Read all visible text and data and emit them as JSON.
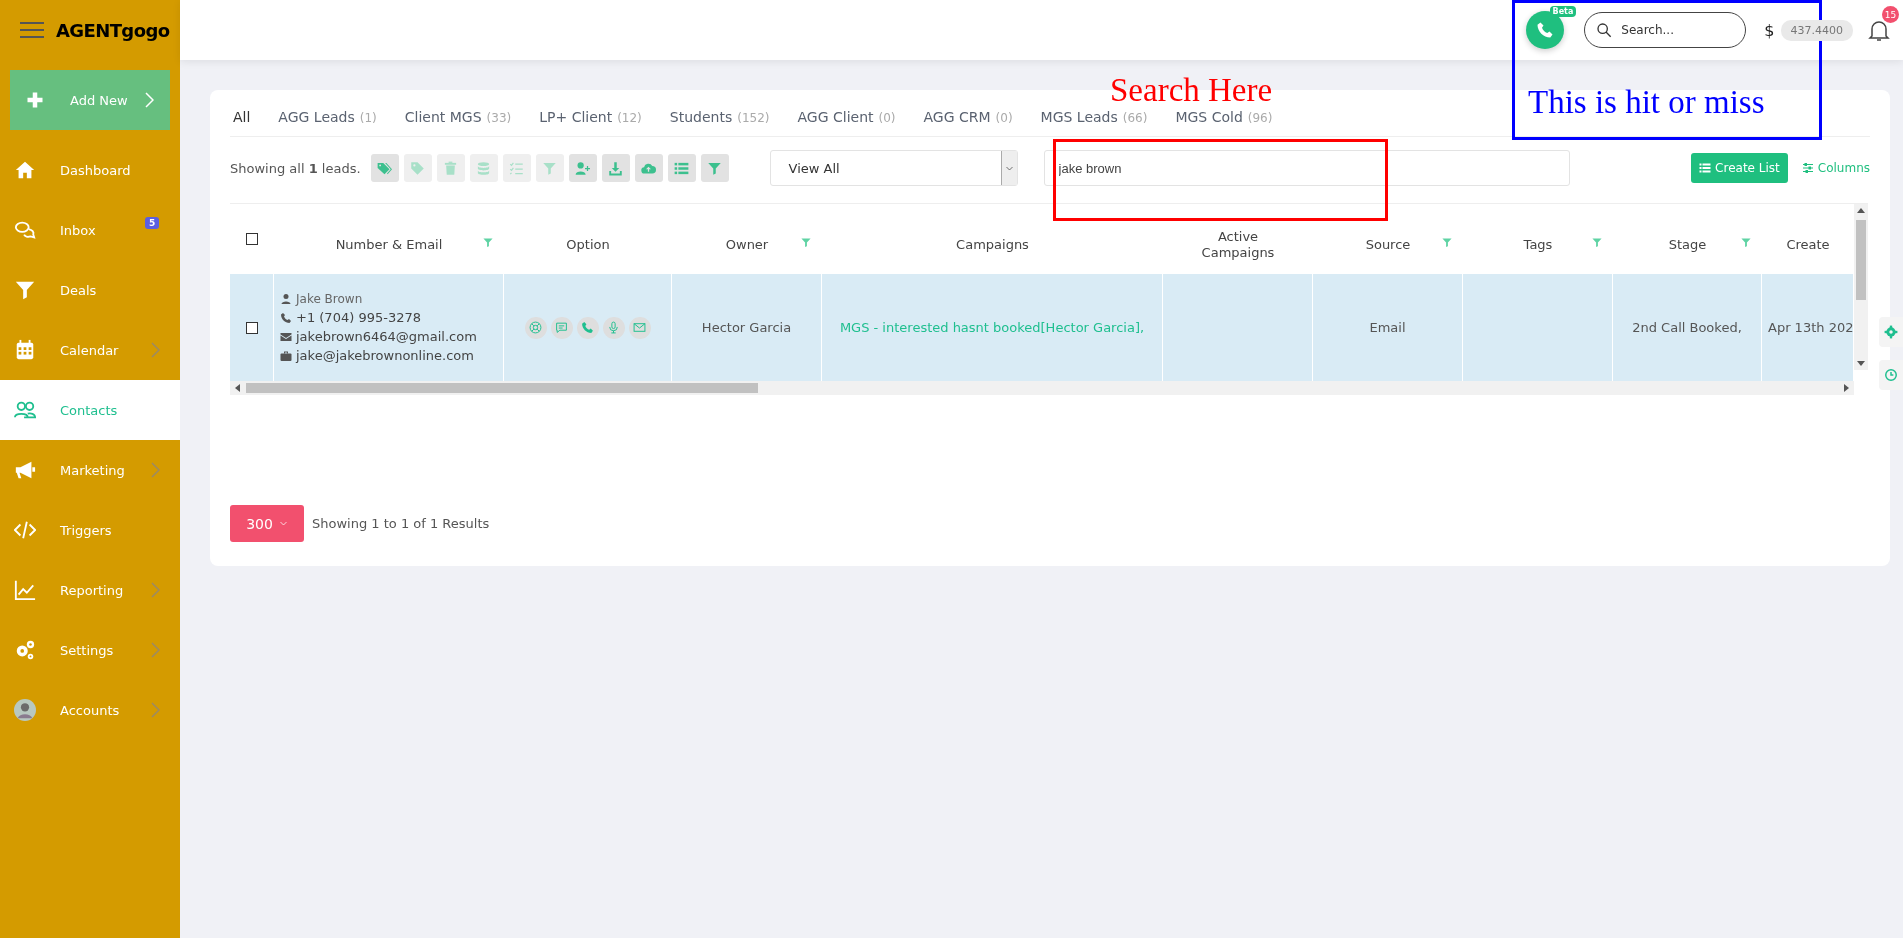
{
  "sidebar": {
    "logo": "AGENTgogo",
    "add_button": "Add New",
    "items": [
      {
        "label": "Dashboard",
        "selected": false,
        "has_submenu": false
      },
      {
        "label": "Inbox",
        "badge": "5",
        "selected": false,
        "has_submenu": false
      },
      {
        "label": "Deals",
        "selected": false,
        "has_submenu": false
      },
      {
        "label": "Calendar",
        "selected": false,
        "has_submenu": true
      },
      {
        "label": "Contacts",
        "selected": true,
        "has_submenu": false
      },
      {
        "label": "Marketing",
        "selected": false,
        "has_submenu": true
      },
      {
        "label": "Triggers",
        "selected": false,
        "has_submenu": false
      },
      {
        "label": "Reporting",
        "selected": false,
        "has_submenu": true
      },
      {
        "label": "Settings",
        "selected": false,
        "has_submenu": true
      },
      {
        "label": "Accounts",
        "selected": false,
        "has_submenu": true
      }
    ]
  },
  "topbar": {
    "phone_badge": "Beta",
    "search": {
      "placeholder": "Search..."
    },
    "currency": "$",
    "balance": "437.4400",
    "notifications": "15"
  },
  "tabs": [
    {
      "label": "All",
      "selected": true
    },
    {
      "label": "AGG Leads",
      "count": "(1)",
      "selected": false
    },
    {
      "label": "Client MGS",
      "count": "(33)",
      "selected": false
    },
    {
      "label": "LP+ Client",
      "count": "(12)",
      "selected": false
    },
    {
      "label": "Students",
      "count": "(152)",
      "selected": false
    },
    {
      "label": "AGG Client",
      "count": "(0)",
      "selected": false
    },
    {
      "label": "AGG CRM",
      "count": "(0)",
      "selected": false
    },
    {
      "label": "MGS Leads",
      "count": "(66)",
      "selected": false
    },
    {
      "label": "MGS Cold",
      "count": "(96)",
      "selected": false
    }
  ],
  "toolbar": {
    "summary": "Showing all **1** leads.",
    "buttons": [
      {
        "disabled": false
      },
      {
        "disabled": true
      },
      {
        "disabled": true
      },
      {
        "disabled": true
      },
      {
        "disabled": true
      },
      {
        "disabled": true
      },
      {
        "disabled": false
      },
      {
        "disabled": false
      },
      {
        "disabled": false
      },
      {
        "disabled": false
      },
      {
        "disabled": false
      }
    ],
    "view_select": {
      "value": "View All"
    },
    "search": {
      "value": "jake brown"
    },
    "create_list": "Create List",
    "columns": "Columns"
  },
  "table": {
    "select_all": {
      "checked": false
    },
    "columns": [
      {
        "label": "Number & Email",
        "filter": true
      },
      {
        "label": "Option",
        "filter": false
      },
      {
        "label": "Owner",
        "filter": true
      },
      {
        "label": "Campaigns",
        "filter": false
      },
      {
        "label": "Active Campaigns",
        "filter": false
      },
      {
        "label": "Source",
        "filter": true
      },
      {
        "label": "Tags",
        "filter": true
      },
      {
        "label": "Stage",
        "filter": true
      },
      {
        "label": "Create",
        "filter": false
      }
    ],
    "rows": [
      {
        "checked": false,
        "highlighted": true,
        "name": "Jake Brown",
        "phone": "+1 (704) 995-3278",
        "email": "jakebrown6464@gmail.com",
        "work_email": "jake@jakebrownonline.com",
        "owner": "Hector Garcia",
        "campaigns": "MGS - interested hasnt booked[Hector Garcia],",
        "source": "Email",
        "stage": "2nd Call Booked,",
        "created": "Apr 13th 202"
      }
    ]
  },
  "pagination": {
    "page_size": "300",
    "summary": "Showing 1 to 1 of 1 Results"
  },
  "annotations": [
    {
      "kind": "red",
      "label": "Search Here"
    },
    {
      "kind": "blue",
      "label": "This is hit or miss"
    }
  ]
}
